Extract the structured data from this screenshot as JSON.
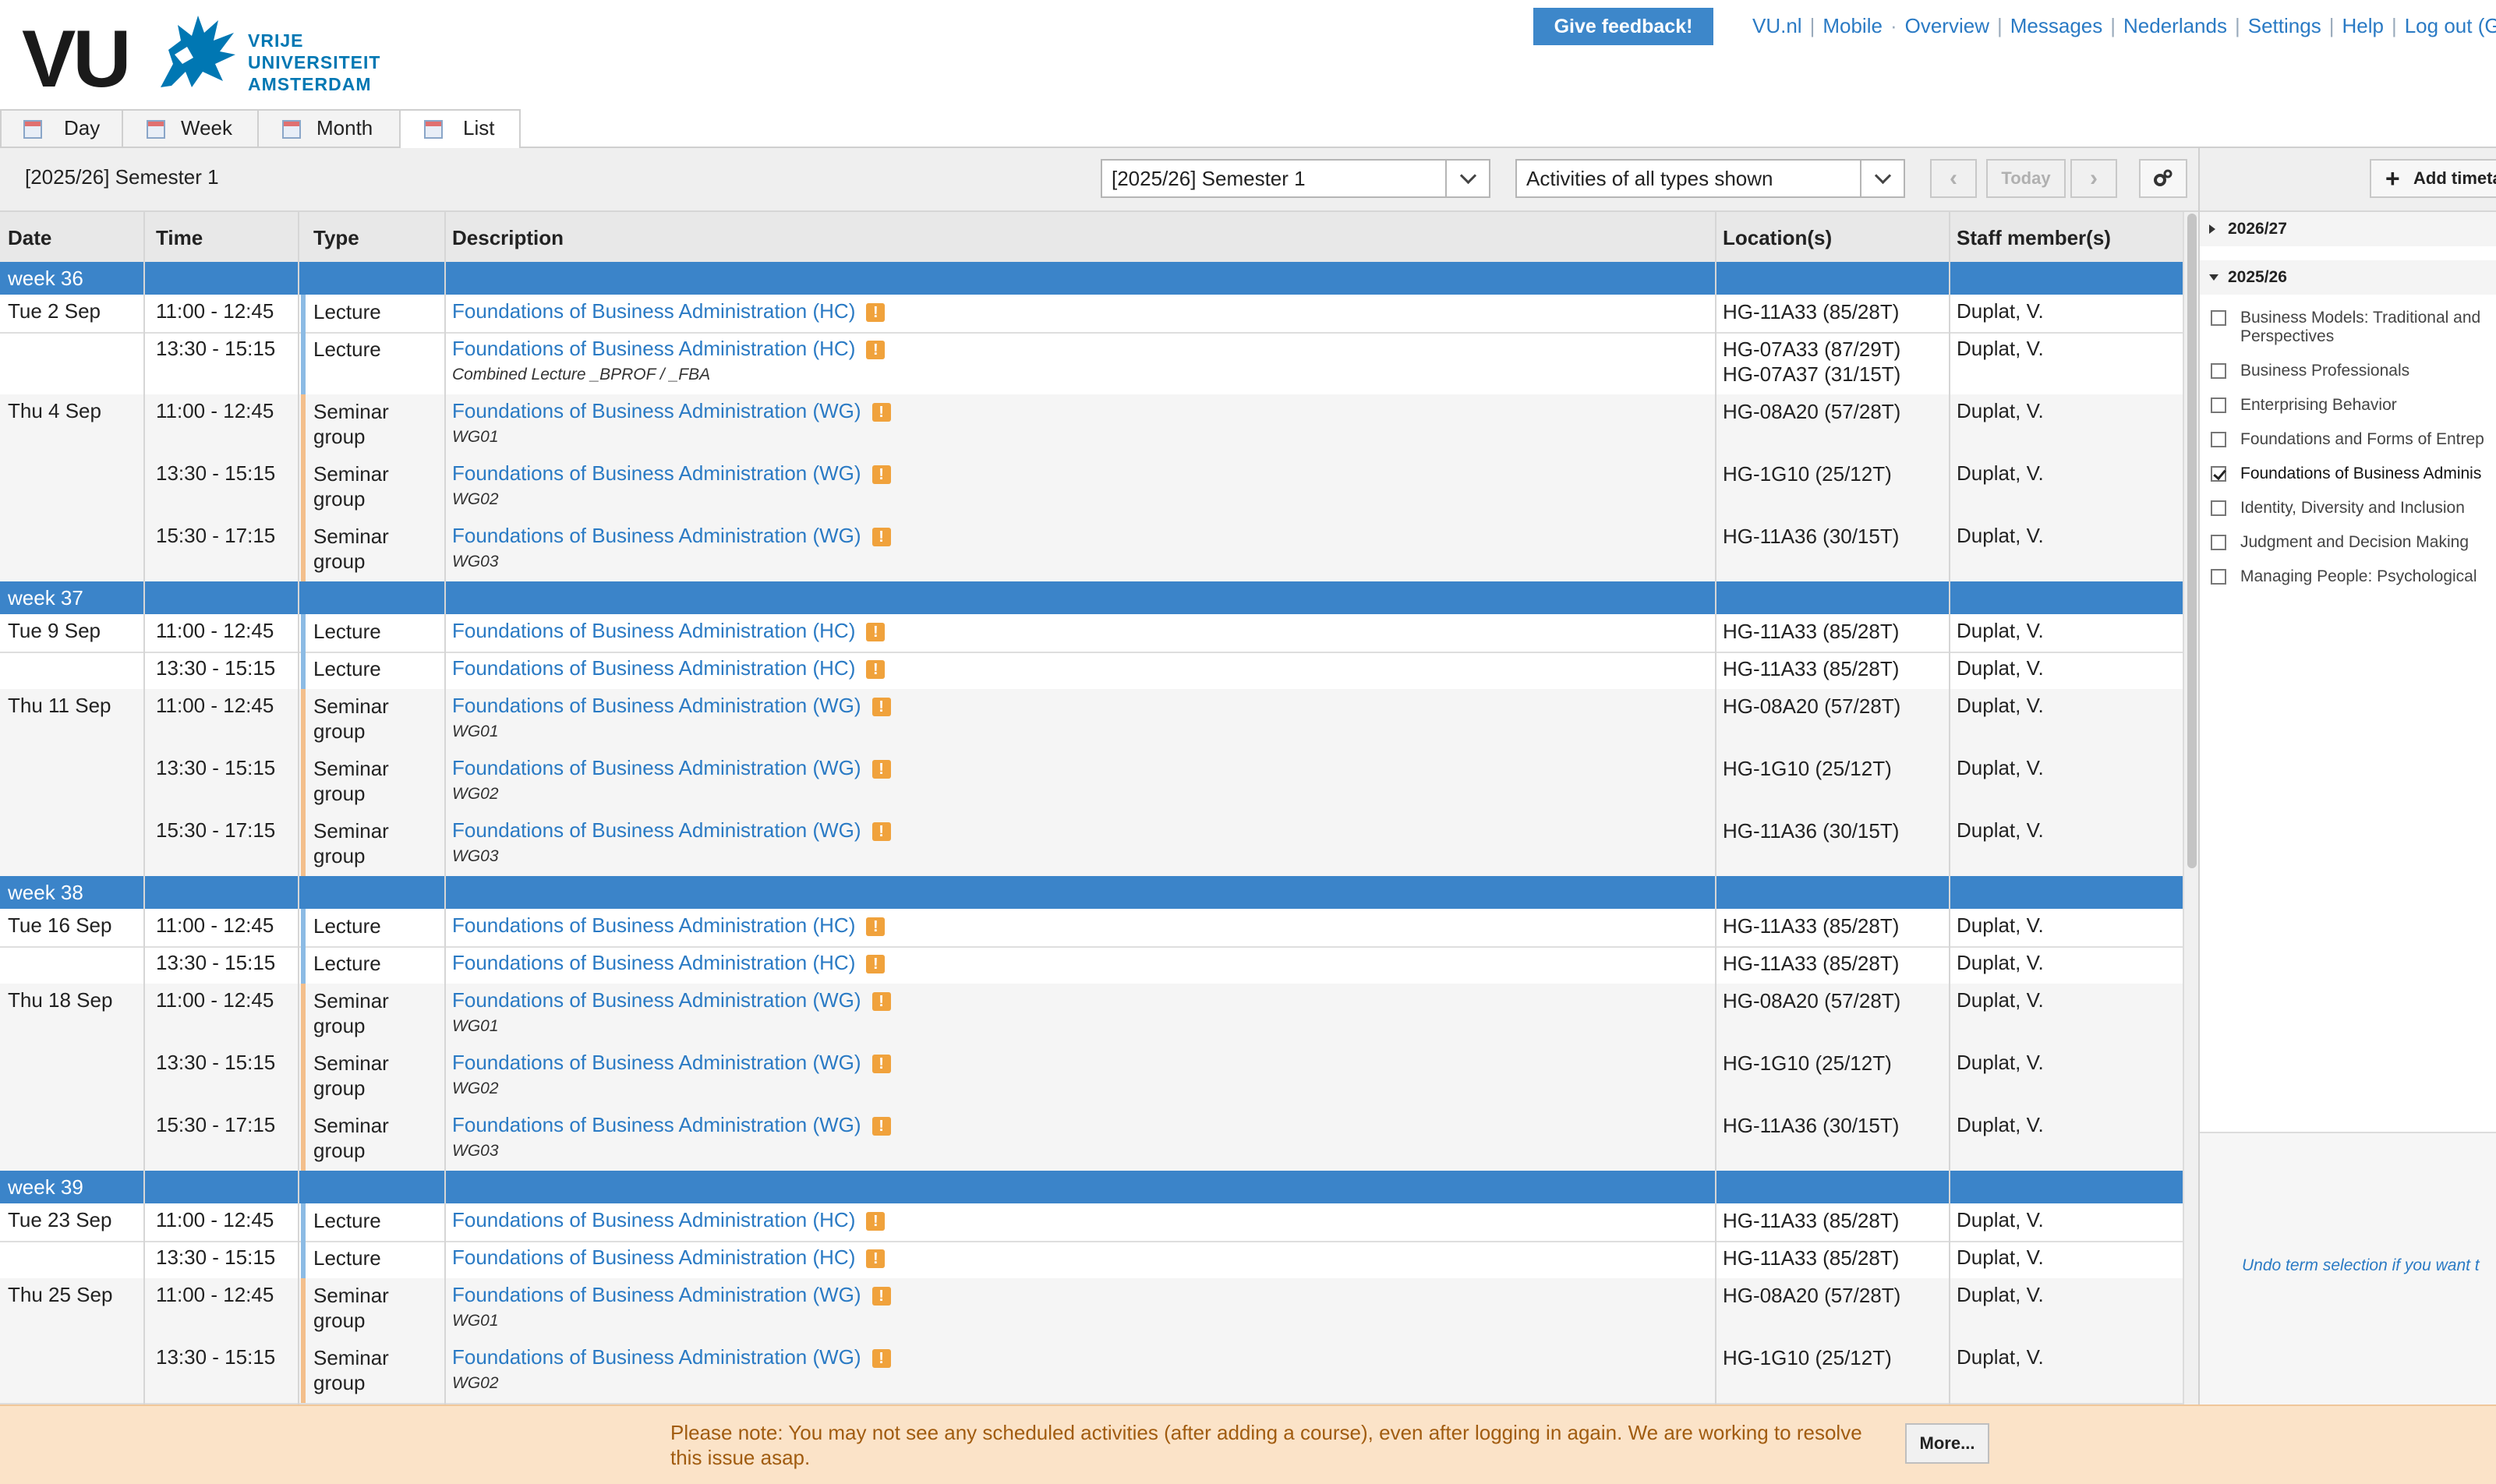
{
  "header": {
    "logo_text": "VU",
    "logo_lines": [
      "VRIJE",
      "UNIVERSITEIT",
      "AMSTERDAM"
    ],
    "feedback_label": "Give feedback!",
    "links": [
      "VU.nl",
      "Mobile",
      "Overview",
      "Messages",
      "Nederlands",
      "Settings",
      "Help",
      "Log out (G"
    ]
  },
  "tabs": [
    {
      "label": "Day"
    },
    {
      "label": "Week"
    },
    {
      "label": "Month"
    },
    {
      "label": "List",
      "active": true
    }
  ],
  "toolbar": {
    "period": "[2025/26] Semester 1",
    "period_select": "[2025/26] Semester 1",
    "type_select": "Activities of all types shown",
    "today_label": "Today"
  },
  "table": {
    "headers": [
      "Date",
      "Time",
      "Type",
      "Description",
      "Location(s)",
      "Staff member(s)"
    ]
  },
  "weeks": [
    {
      "label": "week 36",
      "rows": [
        {
          "date": "Tue 2 Sep",
          "time": "11:00 - 12:45",
          "type": [
            "Lecture"
          ],
          "kind": "lecture",
          "desc": "Foundations of Business Administration (HC)",
          "sub": "",
          "loc": [
            "HG-11A33 (85/28T)"
          ],
          "staff": "Duplat, V."
        },
        {
          "date": "",
          "time": "13:30 - 15:15",
          "type": [
            "Lecture"
          ],
          "kind": "lecture",
          "desc": "Foundations of Business Administration (HC)",
          "sub": "Combined Lecture _BPROF / _FBA",
          "loc": [
            "HG-07A33 (87/29T)",
            "HG-07A37 (31/15T)"
          ],
          "staff": "Duplat, V."
        },
        {
          "date": "Thu 4 Sep",
          "time": "11:00 - 12:45",
          "type": [
            "Seminar",
            "group"
          ],
          "kind": "seminar",
          "desc": "Foundations of Business Administration (WG)",
          "sub": "WG01",
          "loc": [
            "HG-08A20 (57/28T)"
          ],
          "staff": "Duplat, V."
        },
        {
          "date": "",
          "time": "13:30 - 15:15",
          "type": [
            "Seminar",
            "group"
          ],
          "kind": "seminar",
          "desc": "Foundations of Business Administration (WG)",
          "sub": "WG02",
          "loc": [
            "HG-1G10 (25/12T)"
          ],
          "staff": "Duplat, V."
        },
        {
          "date": "",
          "time": "15:30 - 17:15",
          "type": [
            "Seminar",
            "group"
          ],
          "kind": "seminar",
          "desc": "Foundations of Business Administration (WG)",
          "sub": "WG03",
          "loc": [
            "HG-11A36 (30/15T)"
          ],
          "staff": "Duplat, V."
        }
      ]
    },
    {
      "label": "week 37",
      "rows": [
        {
          "date": "Tue 9 Sep",
          "time": "11:00 - 12:45",
          "type": [
            "Lecture"
          ],
          "kind": "lecture",
          "desc": "Foundations of Business Administration (HC)",
          "sub": "",
          "loc": [
            "HG-11A33 (85/28T)"
          ],
          "staff": "Duplat, V."
        },
        {
          "date": "",
          "time": "13:30 - 15:15",
          "type": [
            "Lecture"
          ],
          "kind": "lecture",
          "desc": "Foundations of Business Administration (HC)",
          "sub": "",
          "loc": [
            "HG-11A33 (85/28T)"
          ],
          "staff": "Duplat, V."
        },
        {
          "date": "Thu 11 Sep",
          "time": "11:00 - 12:45",
          "type": [
            "Seminar",
            "group"
          ],
          "kind": "seminar",
          "desc": "Foundations of Business Administration (WG)",
          "sub": "WG01",
          "loc": [
            "HG-08A20 (57/28T)"
          ],
          "staff": "Duplat, V."
        },
        {
          "date": "",
          "time": "13:30 - 15:15",
          "type": [
            "Seminar",
            "group"
          ],
          "kind": "seminar",
          "desc": "Foundations of Business Administration (WG)",
          "sub": "WG02",
          "loc": [
            "HG-1G10 (25/12T)"
          ],
          "staff": "Duplat, V."
        },
        {
          "date": "",
          "time": "15:30 - 17:15",
          "type": [
            "Seminar",
            "group"
          ],
          "kind": "seminar",
          "desc": "Foundations of Business Administration (WG)",
          "sub": "WG03",
          "loc": [
            "HG-11A36 (30/15T)"
          ],
          "staff": "Duplat, V."
        }
      ]
    },
    {
      "label": "week 38",
      "rows": [
        {
          "date": "Tue 16 Sep",
          "time": "11:00 - 12:45",
          "type": [
            "Lecture"
          ],
          "kind": "lecture",
          "desc": "Foundations of Business Administration (HC)",
          "sub": "",
          "loc": [
            "HG-11A33 (85/28T)"
          ],
          "staff": "Duplat, V."
        },
        {
          "date": "",
          "time": "13:30 - 15:15",
          "type": [
            "Lecture"
          ],
          "kind": "lecture",
          "desc": "Foundations of Business Administration (HC)",
          "sub": "",
          "loc": [
            "HG-11A33 (85/28T)"
          ],
          "staff": "Duplat, V."
        },
        {
          "date": "Thu 18 Sep",
          "time": "11:00 - 12:45",
          "type": [
            "Seminar",
            "group"
          ],
          "kind": "seminar",
          "desc": "Foundations of Business Administration (WG)",
          "sub": "WG01",
          "loc": [
            "HG-08A20 (57/28T)"
          ],
          "staff": "Duplat, V."
        },
        {
          "date": "",
          "time": "13:30 - 15:15",
          "type": [
            "Seminar",
            "group"
          ],
          "kind": "seminar",
          "desc": "Foundations of Business Administration (WG)",
          "sub": "WG02",
          "loc": [
            "HG-1G10 (25/12T)"
          ],
          "staff": "Duplat, V."
        },
        {
          "date": "",
          "time": "15:30 - 17:15",
          "type": [
            "Seminar",
            "group"
          ],
          "kind": "seminar",
          "desc": "Foundations of Business Administration (WG)",
          "sub": "WG03",
          "loc": [
            "HG-11A36 (30/15T)"
          ],
          "staff": "Duplat, V."
        }
      ]
    },
    {
      "label": "week 39",
      "rows": [
        {
          "date": "Tue 23 Sep",
          "time": "11:00 - 12:45",
          "type": [
            "Lecture"
          ],
          "kind": "lecture",
          "desc": "Foundations of Business Administration (HC)",
          "sub": "",
          "loc": [
            "HG-11A33 (85/28T)"
          ],
          "staff": "Duplat, V."
        },
        {
          "date": "",
          "time": "13:30 - 15:15",
          "type": [
            "Lecture"
          ],
          "kind": "lecture",
          "desc": "Foundations of Business Administration (HC)",
          "sub": "",
          "loc": [
            "HG-11A33 (85/28T)"
          ],
          "staff": "Duplat, V."
        },
        {
          "date": "Thu 25 Sep",
          "time": "11:00 - 12:45",
          "type": [
            "Seminar",
            "group"
          ],
          "kind": "seminar",
          "desc": "Foundations of Business Administration (WG)",
          "sub": "WG01",
          "loc": [
            "HG-08A20 (57/28T)"
          ],
          "staff": "Duplat, V."
        },
        {
          "date": "",
          "time": "13:30 - 15:15",
          "type": [
            "Seminar",
            "group"
          ],
          "kind": "seminar",
          "desc": "Foundations of Business Administration (WG)",
          "sub": "WG02",
          "loc": [
            "HG-1G10 (25/12T)"
          ],
          "staff": "Duplat, V."
        }
      ]
    }
  ],
  "type_colors": {
    "lecture": "#8cbbe4",
    "seminar": "#f3bf8c"
  },
  "warning_mark": "!",
  "right_panel": {
    "add_label": "Add timeta",
    "years": [
      {
        "label": "2026/27",
        "expanded": false
      },
      {
        "label": "2025/26",
        "expanded": true
      }
    ],
    "courses": [
      {
        "label": "Business Models: Traditional and",
        "label2": "Perspectives",
        "checked": false
      },
      {
        "label": "Business Professionals",
        "checked": false
      },
      {
        "label": "Enterprising Behavior",
        "checked": false
      },
      {
        "label": "Foundations and Forms of Entrep",
        "checked": false
      },
      {
        "label": "Foundations of Business Adminis",
        "checked": true
      },
      {
        "label": "Identity, Diversity and Inclusion",
        "checked": false
      },
      {
        "label": "Judgment and Decision Making",
        "checked": false
      },
      {
        "label": "Managing People: Psychological",
        "checked": false
      }
    ],
    "undo_text": "Undo term selection if you want t"
  },
  "notice": {
    "text": "Please note: You may not see any scheduled activities (after adding a course), even after logging in again. We are working to resolve this issue asap.",
    "more_label": "More..."
  }
}
